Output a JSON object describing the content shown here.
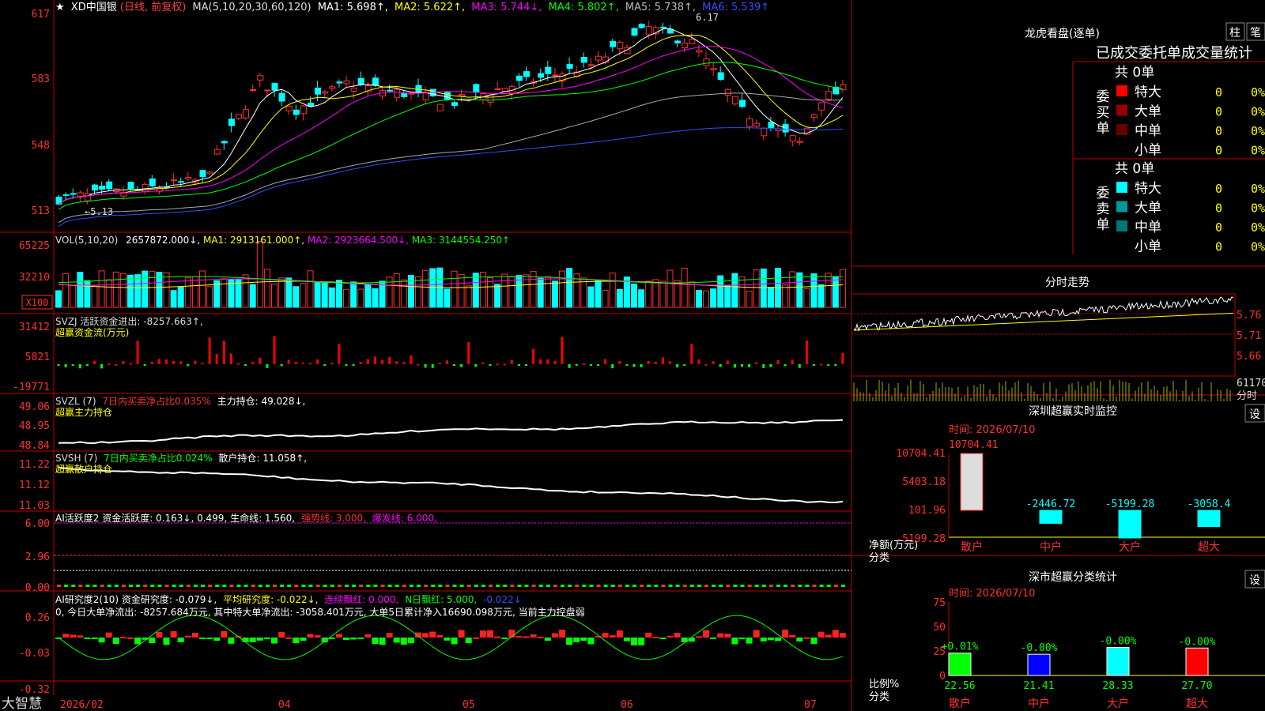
{
  "main": {
    "star": "★",
    "title": "XD中国银",
    "mode": "(日线, 前复权)",
    "ma_hdr": "MA(5,10,20,30,60,120)",
    "ma_vals": [
      "MA1: 5.698↑,",
      "MA2: 5.622↑,",
      "MA3: 5.744↓,",
      "MA4: 5.802↑,",
      "MA5: 5.738↑,",
      "MA6: 5.539↑"
    ],
    "ticks": [
      "617",
      "583",
      "548",
      "513"
    ],
    "hi_label": "6.17",
    "lo_label": "←5.13"
  },
  "vol": {
    "hdr": "VOL(5,10,20)",
    "v0": "2657872.000↓,",
    "v1": "MA1: 2913161.000↑,",
    "v2": "MA2: 2923664.500↓,",
    "v3": "MA3: 3144554.250↑",
    "ticks": [
      "65225",
      "32210"
    ],
    "unit": "X100"
  },
  "svzj": {
    "hdr": "SVZJ  活跃资金进出: -8257.663↑,",
    "sub": "超赢资金流(万元)",
    "ticks": [
      "31412",
      "5821",
      "-19771"
    ]
  },
  "svzl": {
    "hdr1": "SVZL (7)",
    "hdr2": "7日内买卖净占比0.035%",
    "hdr3": "主力持仓: 49.028↓,",
    "sub": "超赢主力持仓",
    "ticks": [
      "49.06",
      "48.95",
      "48.84"
    ]
  },
  "svsh": {
    "hdr1": "SVSH (7)",
    "hdr2": "7日内买卖净占比0.024%",
    "hdr3": "散户持仓: 11.058↑,",
    "sub": "超赢散户持仓",
    "ticks": [
      "11.22",
      "11.12",
      "11.03"
    ]
  },
  "ai1": {
    "hdr1": "AI活跃度2 资金活跃度: 0.163↓, 0.499, 生命线: 1.560,",
    "hdr2": "强势线: 3.000,",
    "hdr3": "爆发线: 6.000,",
    "ticks": [
      "6.00",
      "2.96",
      "0.00"
    ]
  },
  "ai2": {
    "hdr1": "AI研究度2(10) 资金研究度: -0.079↓,",
    "hdr2": "平均研究度: -0.022↓,",
    "hdr3": "连续飘红: 0.000,",
    "hdr4": "N日飘红: 5.000,",
    "hdr5": "-0.022↓",
    "line2": "0, 今日大单净流出: -8257.684万元, 其中特大单净流出: -3058.401万元, 大单5日累计净入16690.098万元, 当前主力控盘弱",
    "ticks": [
      "0.26",
      "-0.03",
      "-0.32"
    ]
  },
  "xaxis": [
    "2026/02",
    "04",
    "05",
    "06",
    "07"
  ],
  "brand": "大智慧",
  "right": {
    "lhb_title": "龙虎看盘(逐单)",
    "btn_zhu": "柱",
    "btn_bi": "笔",
    "stat_title": "已成交委托单成交量统计",
    "buy_label": [
      "委",
      "买",
      "单"
    ],
    "sell_label": [
      "委",
      "卖",
      "单"
    ],
    "buy_total": "共 0单",
    "sell_total": "共 0单",
    "buy_rows": [
      {
        "name": "特大",
        "color": "#ff0000",
        "v": "0",
        "p": "0%"
      },
      {
        "name": "大单",
        "color": "#990000",
        "v": "0",
        "p": "0%"
      },
      {
        "name": "中单",
        "color": "#660000",
        "v": "0",
        "p": "0%"
      },
      {
        "name": "小单",
        "color": "",
        "v": "0",
        "p": "0%"
      }
    ],
    "sell_rows": [
      {
        "name": "特大",
        "color": "#00ffff",
        "v": "0",
        "p": "0%"
      },
      {
        "name": "大单",
        "color": "#009999",
        "v": "0",
        "p": "0%"
      },
      {
        "name": "中单",
        "color": "#007777",
        "v": "0",
        "p": "0%"
      },
      {
        "name": "小单",
        "color": "",
        "v": "0",
        "p": "0%"
      }
    ],
    "fenshi_title": "分时走势",
    "fenshi_ticks": [
      "5.76",
      "5.71",
      "5.66"
    ],
    "fenshi_vol": "61170",
    "fenshi_unit": "分时",
    "sz_title": "深圳超赢实时监控",
    "set": "设",
    "sz_time": "时间: 2026/07/10",
    "sz_top": "10704.41",
    "sz_ticks": [
      "10704.41",
      "5403.18",
      "101.96",
      "-5199.28"
    ],
    "sz_bars": [
      {
        "cat": "散户",
        "v": 10704.41,
        "label": "10704.41"
      },
      {
        "cat": "中户",
        "v": -2446.72,
        "label": "-2446.72"
      },
      {
        "cat": "大户",
        "v": -5199.28,
        "label": "-5199.28"
      },
      {
        "cat": "超大",
        "v": -3058.4,
        "label": "-3058.4"
      }
    ],
    "sz_ylabel": "净额(万元)",
    "sz_xlabel": "分类",
    "sc_title": "深市超赢分类统计",
    "sc_time": "时间: 2026/07/10",
    "sc_ticks": [
      "75",
      "50",
      "25",
      "0"
    ],
    "sc_bars": [
      {
        "cat": "散户",
        "pct": 22.56,
        "label": "22.56",
        "top": "+0.01%",
        "color": "#00ff00"
      },
      {
        "cat": "中户",
        "pct": 21.41,
        "label": "21.41",
        "top": "-0.00%",
        "color": "#0000ff"
      },
      {
        "cat": "大户",
        "pct": 28.33,
        "label": "28.33",
        "top": "-0.00%",
        "color": "#00ffff"
      },
      {
        "cat": "超大",
        "pct": 27.7,
        "label": "27.70",
        "top": "-0.00%",
        "color": "#ff0000"
      }
    ],
    "sc_ylabel": "比例%",
    "sc_xlabel": "分类"
  }
}
